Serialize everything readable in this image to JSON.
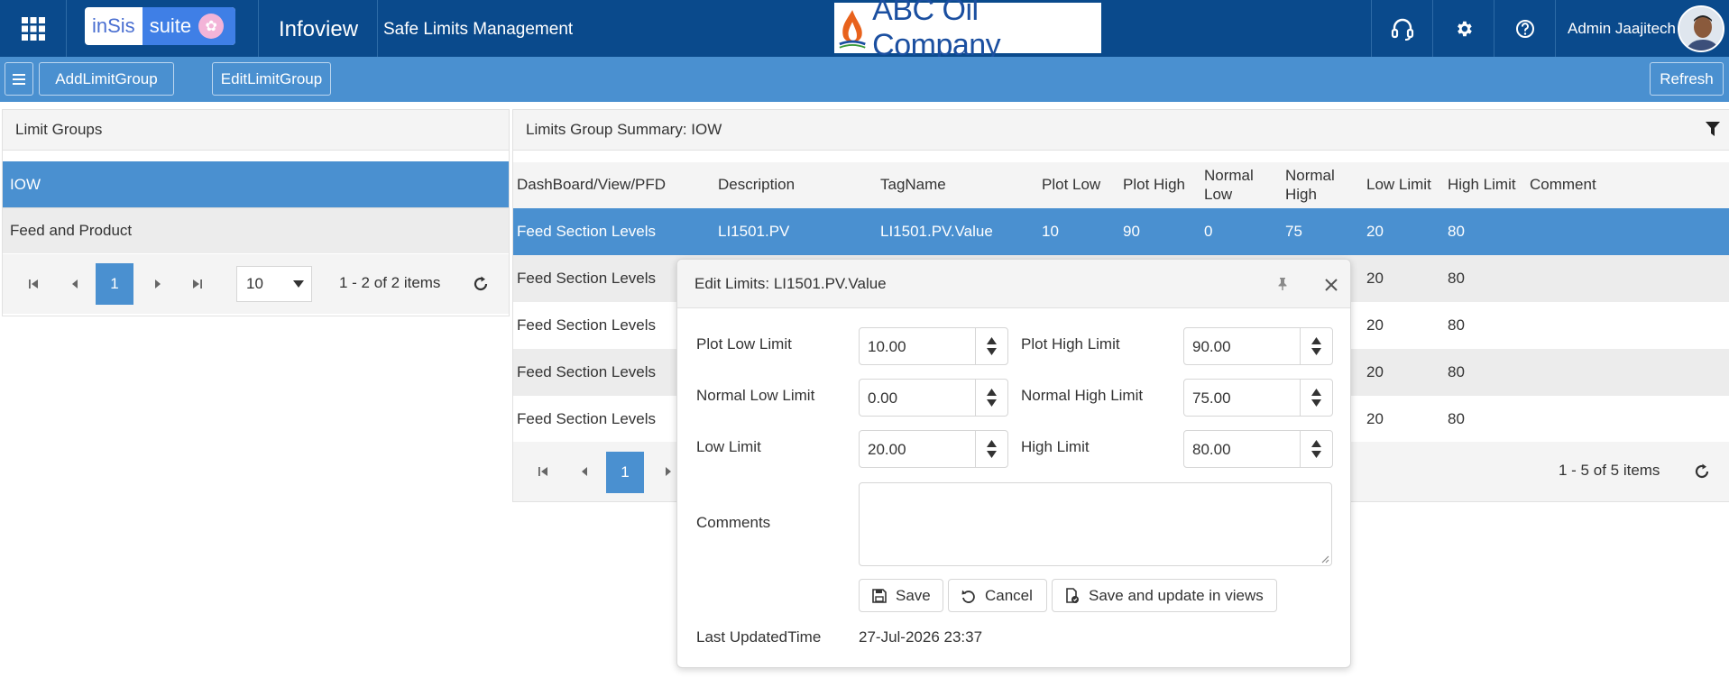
{
  "header": {
    "logo_insis": "inSis",
    "logo_suite": "suite",
    "app_title": "Infoview",
    "page_title": "Safe Limits Management",
    "company": "ABC Oil Company",
    "user": "Admin Jaajitech",
    "bg_color": "#0a4a8c"
  },
  "toolbar": {
    "add_label": "AddLimitGroup",
    "edit_label": "EditLimitGroup",
    "refresh_label": "Refresh",
    "bg_color": "#4a90d0"
  },
  "limit_groups": {
    "title": "Limit Groups",
    "items": [
      {
        "label": "IOW",
        "selected": true
      },
      {
        "label": "Feed and Product",
        "selected": false
      }
    ],
    "pager": {
      "page": "1",
      "page_size": "10",
      "info": "1 - 2 of 2 items"
    }
  },
  "summary": {
    "title": "Limits Group Summary: IOW",
    "columns": [
      "DashBoard/View/PFD",
      "Description",
      "TagName",
      "Plot Low",
      "Plot High",
      "Normal Low",
      "Normal High",
      "Low Limit",
      "High Limit",
      "Comment"
    ],
    "rows": [
      {
        "dashboard": "Feed Section Levels",
        "description": "LI1501.PV",
        "tagname": "LI1501.PV.Value",
        "plot_low": "10",
        "plot_high": "90",
        "normal_low": "0",
        "normal_high": "75",
        "low_limit": "20",
        "high_limit": "80",
        "comment": ""
      },
      {
        "dashboard": "Feed Section Levels",
        "low_limit": "20",
        "high_limit": "80"
      },
      {
        "dashboard": "Feed Section Levels",
        "low_limit": "20",
        "high_limit": "80"
      },
      {
        "dashboard": "Feed Section Levels",
        "low_limit": "20",
        "high_limit": "80"
      },
      {
        "dashboard": "Feed Section Levels",
        "low_limit": "20",
        "high_limit": "80"
      }
    ],
    "pager": {
      "page": "1",
      "info": "1 - 5 of 5 items"
    }
  },
  "dialog": {
    "title": "Edit Limits: LI1501.PV.Value",
    "plot_low_label": "Plot Low Limit",
    "plot_low_value": "10.00",
    "plot_high_label": "Plot High Limit",
    "plot_high_value": "90.00",
    "normal_low_label": "Normal Low Limit",
    "normal_low_value": "0.00",
    "normal_high_label": "Normal High Limit",
    "normal_high_value": "75.00",
    "low_label": "Low Limit",
    "low_value": "20.00",
    "high_label": "High Limit",
    "high_value": "80.00",
    "comments_label": "Comments",
    "comments_value": "",
    "save_label": "Save",
    "cancel_label": "Cancel",
    "save_update_label": "Save and update in views",
    "last_updated_label": "Last UpdatedTime",
    "last_updated_value": "27-Jul-2026 23:37"
  },
  "colors": {
    "selected_row": "#4a90d0",
    "alt_row": "#ececec"
  }
}
